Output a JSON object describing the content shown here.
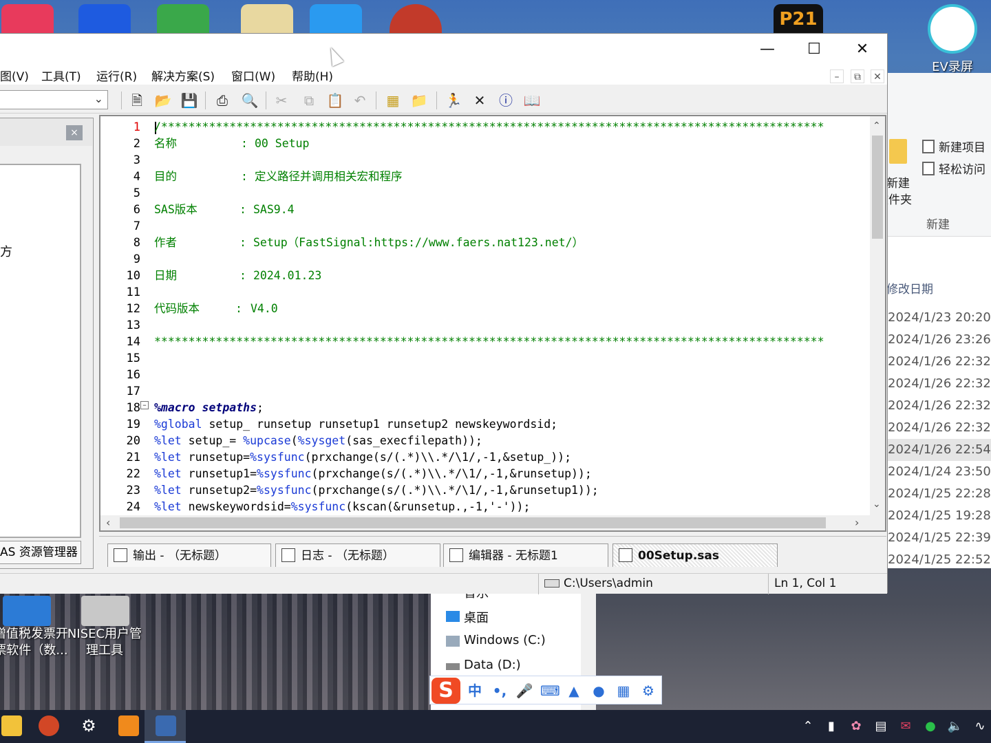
{
  "desktop": {
    "ev_label": "EV录屏",
    "p21_label": "P21",
    "icon1_label": "增值税发票开票软件（数...",
    "icon1_line1": "增值税发票开",
    "icon1_line2": "票软件（数...",
    "icon2_line1": "NISEC用户管",
    "icon2_line2": "理工具"
  },
  "explorer": {
    "ribbon": {
      "new_item": "新建项目",
      "easy_access": "轻松访问",
      "new_folder_1": "新建",
      "new_folder_2": "文件夹",
      "group_label": "新建"
    },
    "column_header": "修改日期",
    "dates": [
      "2024/1/23 20:20",
      "2024/1/26 23:26",
      "2024/1/26 22:32",
      "2024/1/26 22:32",
      "2024/1/26 22:32",
      "2024/1/26 22:32",
      "2024/1/26 22:54",
      "2024/1/24 23:50",
      "2024/1/25 22:28",
      "2024/1/25 19:28",
      "2024/1/25 22:39",
      "2024/1/25 22:52"
    ],
    "nav": {
      "music": "音乐",
      "desktop": "桌面",
      "c_drive": "Windows (C:)",
      "d_drive": "Data (D:)"
    }
  },
  "ime": {
    "logo": "S",
    "lang": "中",
    "punct": "•,"
  },
  "sas": {
    "menu": {
      "view": "图(V)",
      "tools": "工具(T)",
      "run": "运行(R)",
      "solutions": "解决方案(S)",
      "window": "窗口(W)",
      "help": "帮助(H)"
    },
    "side_panel": {
      "truncated_text": "方",
      "tab_label": "AS 资源管理器"
    },
    "editor": {
      "line_numbers": [
        "1",
        "2",
        "3",
        "4",
        "5",
        "6",
        "7",
        "8",
        "9",
        "10",
        "11",
        "12",
        "13",
        "14",
        "15",
        "16",
        "17",
        "18",
        "19",
        "20",
        "21",
        "22",
        "23",
        "24"
      ],
      "stars": "/*************************************************************************************************",
      "stars_end": "**************************************************************************************************",
      "name_key": "名称",
      "name_val": "00 Setup",
      "purpose_key": "目的",
      "purpose_val": "定义路径并调用相关宏和程序",
      "sasver_key": "SAS版本",
      "sasver_val": "SAS9.4",
      "author_key": "作者",
      "author_val": "Setup（FastSignal:https://www.faers.nat123.net/）",
      "date_key": "日期",
      "date_val": "2024.01.23",
      "codever_key": "代码版本",
      "codever_val": "V4.0",
      "colon": ":",
      "l18_kw": "%macro",
      "l18_name": "setpaths",
      "l18_end": ";",
      "l19_kw": "%global",
      "l19_rest": " setup_ runsetup runsetup1 runsetup2 newskeywordsid;",
      "l20_kw": "%let",
      "l20_a": " setup_= ",
      "l20_f1": "%upcase",
      "l20_b": "(",
      "l20_f2": "%sysget",
      "l20_c": "(sas_execfilepath));",
      "l21_kw": "%let",
      "l21_a": " runsetup=",
      "l21_f": "%sysfunc",
      "l21_b": "(prxchange(s/(.*)\\\\.*/\\1/,-1,&setup_));",
      "l22_kw": "%let",
      "l22_a": " runsetup1=",
      "l22_f": "%sysfunc",
      "l22_b": "(prxchange(s/(.*)\\\\.*/\\1/,-1,&runsetup));",
      "l23_kw": "%let",
      "l23_a": " runsetup2=",
      "l23_f": "%sysfunc",
      "l23_b": "(prxchange(s/(.*)\\\\.*/\\1/,-1,&runsetup1));",
      "l24_kw": "%let",
      "l24_a": " newskeywordsid=",
      "l24_f": "%sysfunc",
      "l24_b": "(kscan(&runsetup.,-1,'-'));"
    },
    "tabs": {
      "output": "输出 - （无标题）",
      "log": "日志 - （无标题）",
      "editor": "编辑器 - 无标题1",
      "active": "00Setup.sas"
    },
    "status": {
      "path": "C:\\Users\\admin",
      "position": "Ln 1, Col 1"
    }
  },
  "colors": {
    "comment": "#008000",
    "macro_keyword": "#1a3ad6",
    "current_line_number": "#e00000"
  }
}
